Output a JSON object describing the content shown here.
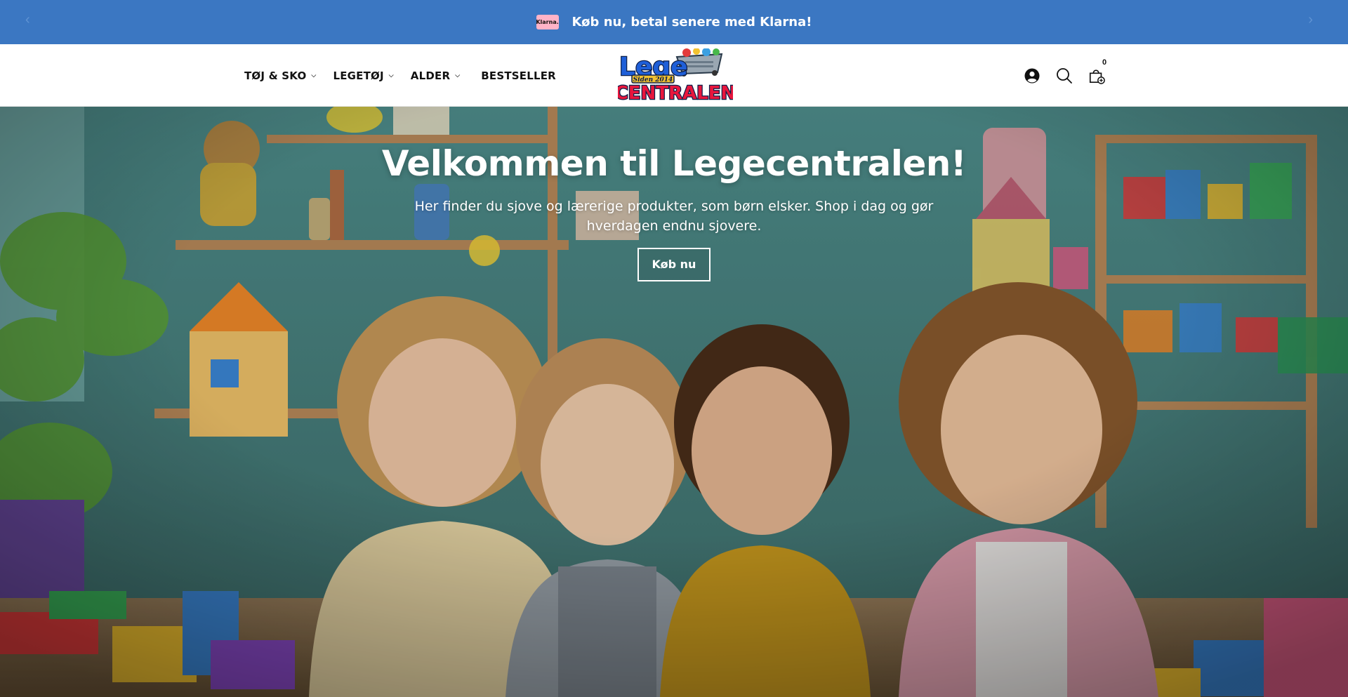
{
  "announcement": {
    "badge_text": "Klarna.",
    "text": "Køb nu, betal senere med Klarna!",
    "background": "#3b77c2"
  },
  "nav": {
    "items": [
      {
        "label": "TØJ & SKO",
        "has_dropdown": true
      },
      {
        "label": "LEGETØJ",
        "has_dropdown": true
      },
      {
        "label": "ALDER",
        "has_dropdown": true
      },
      {
        "label": "BESTSELLER",
        "has_dropdown": false
      }
    ]
  },
  "logo": {
    "line1": "Lege",
    "tagline": "Siden 2014",
    "line2": "CENTRALEN"
  },
  "header_icons": {
    "account": "account-icon",
    "search": "search-icon",
    "cart": "cart-icon",
    "cart_count": "0"
  },
  "hero": {
    "title": "Velkommen til Legecentralen!",
    "subtitle": "Her finder du sjove og lærerige produkter, som børn elsker. Shop i dag og gør hverdagen endnu sjovere.",
    "button_label": "Køb nu"
  }
}
